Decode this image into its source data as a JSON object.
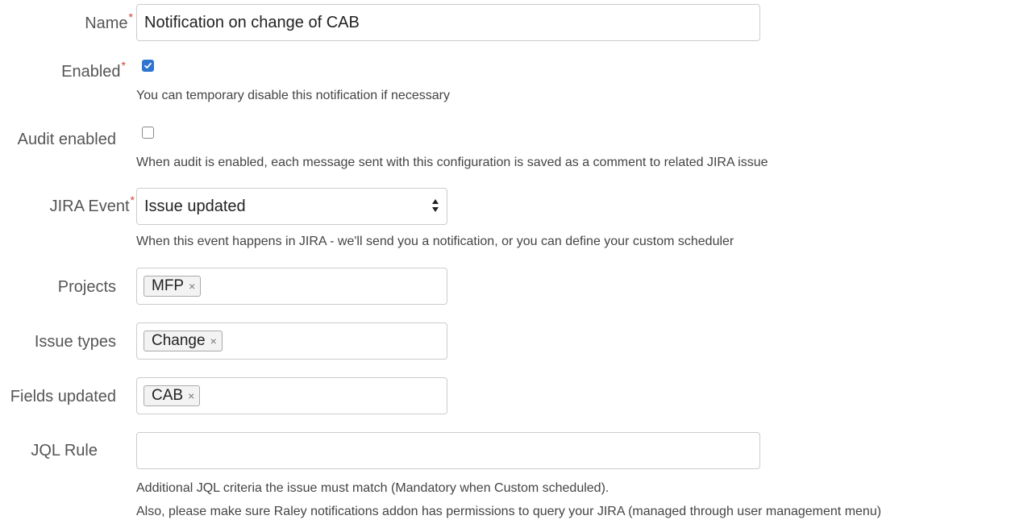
{
  "name": {
    "label": "Name",
    "value": "Notification on change of CAB"
  },
  "enabled": {
    "label": "Enabled",
    "checked": true,
    "help": "You can temporary disable this notification if necessary"
  },
  "audit": {
    "label": "Audit enabled",
    "checked": false,
    "help": "When audit is enabled, each message sent with this configuration is saved as a comment to related JIRA issue"
  },
  "jira_event": {
    "label": "JIRA Event",
    "selected": "Issue updated",
    "help": "When this event happens in JIRA - we'll send you a notification, or you can define your custom scheduler"
  },
  "projects": {
    "label": "Projects",
    "tags": [
      "MFP"
    ]
  },
  "issue_types": {
    "label": "Issue types",
    "tags": [
      "Change"
    ]
  },
  "fields_updated": {
    "label": "Fields updated",
    "tags": [
      "CAB"
    ]
  },
  "jql": {
    "label": "JQL Rule",
    "value": "",
    "help_line1": "Additional JQL criteria the issue must match (Mandatory when Custom scheduled).",
    "help_line2": "Also, please make sure Raley notifications addon has permissions to query your JIRA (managed through user management menu)"
  },
  "required_marker": "*",
  "tag_remove_glyph": "×",
  "colors": {
    "checkbox_checked": "#2f74d0",
    "required": "#d04437",
    "border": "#cccccc"
  }
}
